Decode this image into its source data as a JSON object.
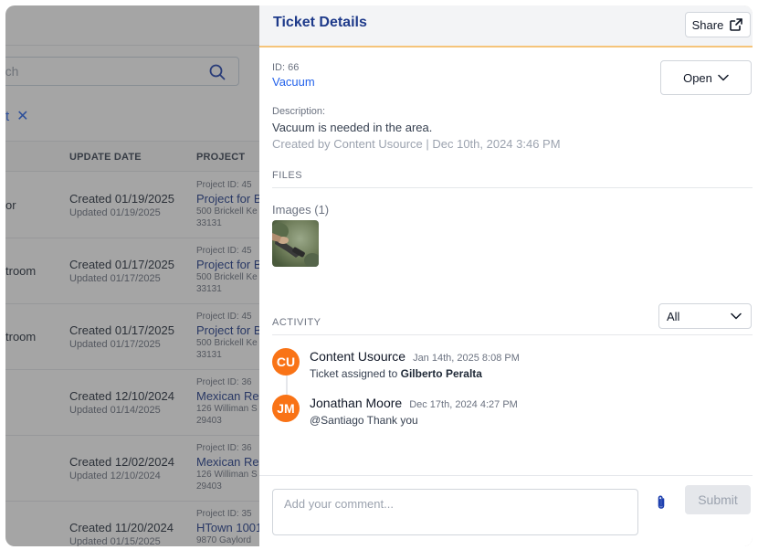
{
  "background": {
    "search": {
      "placeholder": "rch"
    },
    "filter_chip": {
      "label": "t"
    },
    "table_headers": {
      "update_date": "UPDATE DATE",
      "project": "PROJECT"
    },
    "rows": [
      {
        "left": "or",
        "created": "Created 01/19/2025",
        "updated": "Updated 01/19/2025",
        "project_id": "Project ID: 45",
        "project_name": "Project for B",
        "address": "500 Brickell Ke",
        "zip": "33131"
      },
      {
        "left": "troom",
        "created": "Created 01/17/2025",
        "updated": "Updated 01/17/2025",
        "project_id": "Project ID: 45",
        "project_name": "Project for B",
        "address": "500 Brickell Ke",
        "zip": "33131"
      },
      {
        "left": "troom",
        "created": "Created 01/17/2025",
        "updated": "Updated 01/17/2025",
        "project_id": "Project ID: 45",
        "project_name": "Project for B",
        "address": "500 Brickell Ke",
        "zip": "33131"
      },
      {
        "left": "",
        "created": "Created 12/10/2024",
        "updated": "Updated 01/14/2025",
        "project_id": "Project ID: 36",
        "project_name": "Mexican Res",
        "address": "126 Williman S",
        "zip": "29403"
      },
      {
        "left": "",
        "created": "Created 12/02/2024",
        "updated": "Updated 12/10/2024",
        "project_id": "Project ID: 36",
        "project_name": "Mexican Res",
        "address": "126 Williman S",
        "zip": "29403"
      },
      {
        "left": "",
        "created": "Created 11/20/2024",
        "updated": "Updated 01/15/2025",
        "project_id": "Project ID: 35",
        "project_name": "HTown 1001",
        "address": "9870 Gaylord",
        "zip": ""
      }
    ]
  },
  "drawer": {
    "title": "Ticket Details",
    "share_label": "Share",
    "id_label": "ID: 66",
    "ticket_name": "Vacuum",
    "status": "Open",
    "description_label": "Description:",
    "description": "Vacuum is needed in the area.",
    "created_by": "Created by Content Usource | Dec 10th, 2024 3:46 PM",
    "files_label": "FILES",
    "images_label": "Images (1)",
    "activity_label": "ACTIVITY",
    "activity_filter": "All",
    "activities": [
      {
        "initials": "CU",
        "name": "Content Usource",
        "time": "Jan 14th, 2025 8:08 PM",
        "text": "Ticket assigned to ",
        "bold": "Gilberto Peralta"
      },
      {
        "initials": "JM",
        "name": "Jonathan Moore",
        "time": "Dec 17th, 2024 4:27 PM",
        "text": "@Santiago Thank you",
        "bold": ""
      }
    ],
    "comment_placeholder": "Add your comment...",
    "submit_label": "Submit"
  },
  "colors": {
    "accent": "#f97316",
    "link": "#2563eb",
    "title": "#1e3a8a",
    "header_border": "#f5c47a"
  }
}
